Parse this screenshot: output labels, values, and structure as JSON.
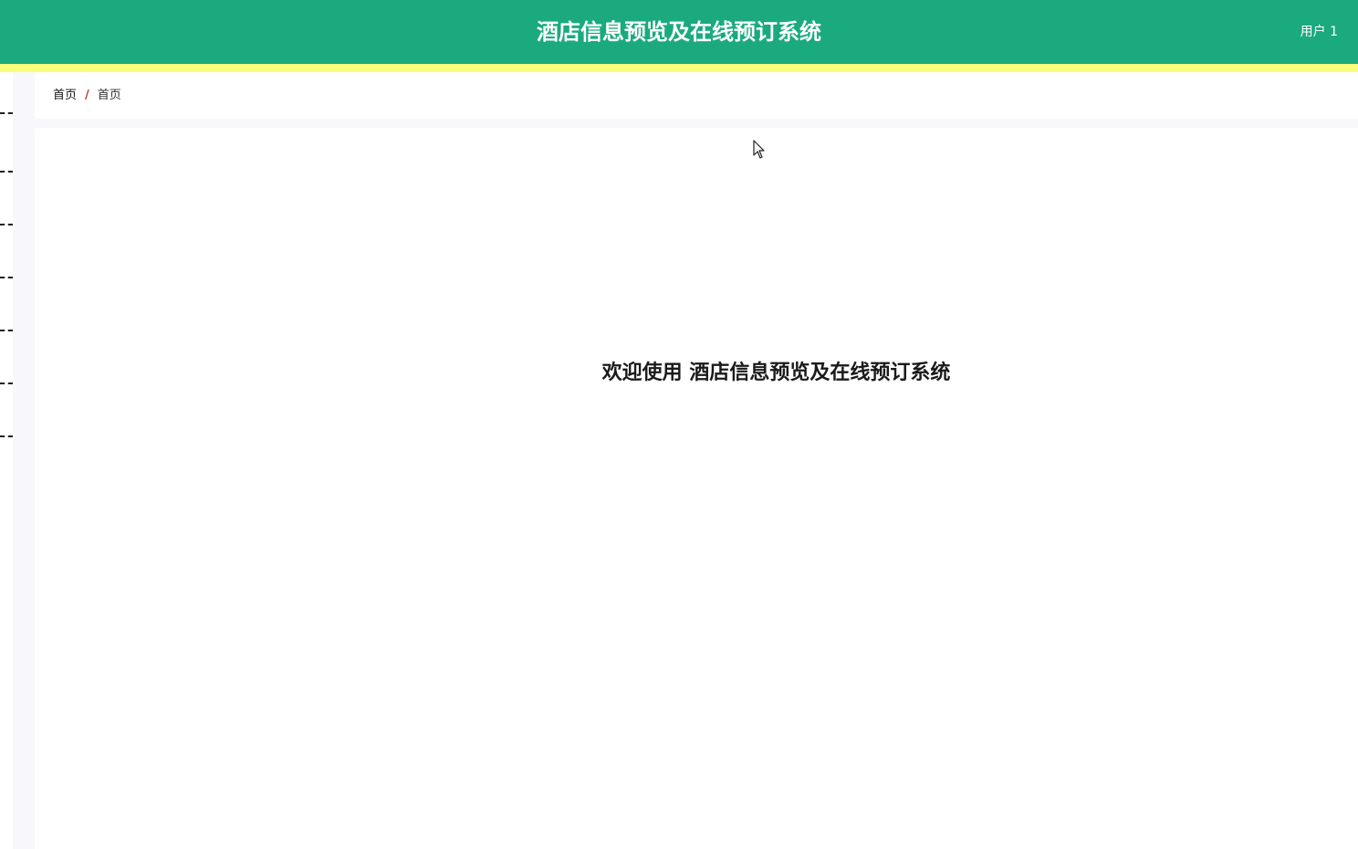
{
  "header": {
    "title": "酒店信息预览及在线预订系统",
    "user_label": "用户 1"
  },
  "sidebar": {
    "items": [
      {
        "icon": "collapsed-menu-dash-icon"
      },
      {
        "icon": "collapsed-menu-dash-icon"
      },
      {
        "icon": "collapsed-menu-dash-icon"
      },
      {
        "icon": "collapsed-menu-dash-icon"
      },
      {
        "icon": "collapsed-menu-dash-icon"
      },
      {
        "icon": "collapsed-menu-dash-icon"
      },
      {
        "icon": "collapsed-menu-dash-icon"
      }
    ]
  },
  "breadcrumb": {
    "items": [
      "首页",
      "首页"
    ],
    "separator": "/"
  },
  "main": {
    "welcome_text": "欢迎使用 酒店信息预览及在线预订系统"
  },
  "colors": {
    "header_bg": "#1aaa7e",
    "accent_strip": "#fbff7a",
    "separator": "#c0392b"
  }
}
